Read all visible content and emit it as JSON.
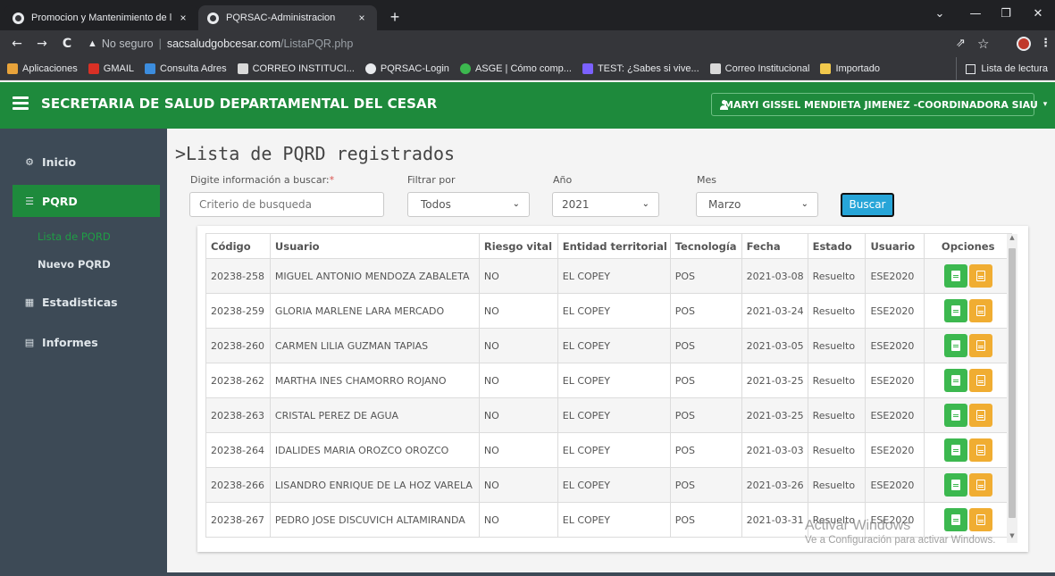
{
  "browser": {
    "tabs": [
      {
        "title": "Promocion y Mantenimiento de l",
        "close": "×"
      },
      {
        "title": "PQRSAC-Administracion",
        "close": "×"
      }
    ],
    "new_tab": "+",
    "window_controls": {
      "chevron": "⌄",
      "minimize": "—",
      "maximize": "❐",
      "close": "✕"
    },
    "nav": {
      "back": "←",
      "forward": "→",
      "reload": "C"
    },
    "address": {
      "warn_icon": "▲",
      "not_secure": "No seguro",
      "separator": "|",
      "host": "sacsaludgobcesar.com",
      "path": "/ListaPQR.php"
    },
    "address_icons": {
      "share": "⇗",
      "star": "☆",
      "menu": "⋮"
    },
    "bookmarks": [
      {
        "label": "Aplicaciones",
        "icon": "apps-grid-icon",
        "color": "#e8a33a"
      },
      {
        "label": "GMAIL",
        "icon": "gmail-icon",
        "color": "#d93025"
      },
      {
        "label": "Consulta Adres",
        "icon": "adres-icon",
        "color": "#3c8dde"
      },
      {
        "label": "CORREO INSTITUCI...",
        "icon": "office-icon",
        "color": "#d9d9d9"
      },
      {
        "label": "PQRSAC-Login",
        "icon": "globe-icon",
        "color": "#e8eaed"
      },
      {
        "label": "ASGE | Cómo comp...",
        "icon": "asge-icon",
        "color": "#3cb84f"
      },
      {
        "label": "TEST: ¿Sabes si vive...",
        "icon": "form-icon",
        "color": "#7b61ff"
      },
      {
        "label": "Correo Institucional",
        "icon": "office-icon",
        "color": "#d9d9d9"
      },
      {
        "label": "Importado",
        "icon": "folder-icon",
        "color": "#f2c94c"
      }
    ],
    "reading_list": "Lista de lectura"
  },
  "header": {
    "title": "SECRETARIA DE SALUD DEPARTAMENTAL DEL CESAR",
    "user": "MARYI GISSEL MENDIETA JIMENEZ -COORDINADORA SIAU",
    "caret": "▾"
  },
  "sidebar": {
    "items": [
      {
        "label": "Inicio",
        "icon": "⚙"
      },
      {
        "label": "PQRD",
        "icon": "☰"
      },
      {
        "label": "Estadisticas",
        "icon": "▦"
      },
      {
        "label": "Informes",
        "icon": "▤"
      }
    ],
    "sub_items": [
      {
        "label": "Lista de PQRD"
      },
      {
        "label": "Nuevo PQRD"
      }
    ]
  },
  "main": {
    "title": ">Lista de PQRD registrados",
    "filters": {
      "search_label": "Digite información a buscar:",
      "required_mark": "*",
      "search_placeholder": "Criterio de busqueda",
      "filter_label": "Filtrar por",
      "filter_value": "Todos",
      "year_label": "Año",
      "year_value": "2021",
      "month_label": "Mes",
      "month_value": "Marzo",
      "select_arrow": "⌄",
      "search_button": "Buscar"
    },
    "table": {
      "columns": [
        "Código",
        "Usuario",
        "Riesgo vital",
        "Entidad territorial",
        "Tecnología",
        "Fecha",
        "Estado",
        "Usuario",
        "Opciones"
      ],
      "rows": [
        [
          "20238-258",
          "MIGUEL ANTONIO MENDOZA ZABALETA",
          "NO",
          "EL COPEY",
          "POS",
          "2021-03-08",
          "Resuelto",
          "ESE2020"
        ],
        [
          "20238-259",
          "GLORIA MARLENE LARA MERCADO",
          "NO",
          "EL COPEY",
          "POS",
          "2021-03-24",
          "Resuelto",
          "ESE2020"
        ],
        [
          "20238-260",
          "CARMEN LILIA GUZMAN TAPIAS",
          "NO",
          "EL COPEY",
          "POS",
          "2021-03-05",
          "Resuelto",
          "ESE2020"
        ],
        [
          "20238-262",
          "MARTHA INES CHAMORRO ROJANO",
          "NO",
          "EL COPEY",
          "POS",
          "2021-03-25",
          "Resuelto",
          "ESE2020"
        ],
        [
          "20238-263",
          "CRISTAL PEREZ DE AGUA",
          "NO",
          "EL COPEY",
          "POS",
          "2021-03-25",
          "Resuelto",
          "ESE2020"
        ],
        [
          "20238-264",
          "IDALIDES MARIA OROZCO OROZCO",
          "NO",
          "EL COPEY",
          "POS",
          "2021-03-03",
          "Resuelto",
          "ESE2020"
        ],
        [
          "20238-266",
          "LISANDRO ENRIQUE DE LA HOZ VARELA",
          "NO",
          "EL COPEY",
          "POS",
          "2021-03-26",
          "Resuelto",
          "ESE2020"
        ],
        [
          "20238-267",
          "PEDRO JOSE DISCUVICH ALTAMIRANDA",
          "NO",
          "EL COPEY",
          "POS",
          "2021-03-31",
          "Resuelto",
          "ESE2020"
        ]
      ]
    },
    "scroll": {
      "up": "▲",
      "down": "▼"
    }
  },
  "watermark": {
    "line1": "Activar Windows",
    "line2": "Ve a Configuración para activar Windows."
  },
  "colors": {
    "primary_green": "#1e8a3c",
    "sidebar": "#3d4a56",
    "button_blue": "#27a5d8",
    "action_green": "#3cb84f",
    "action_orange": "#f0ad32"
  }
}
